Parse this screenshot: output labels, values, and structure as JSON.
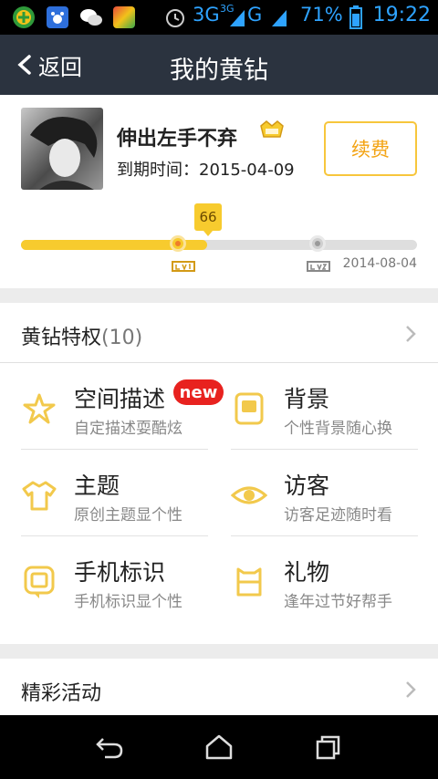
{
  "status_bar": {
    "network": "3G",
    "network_small": "3G",
    "network2": "G",
    "battery": "71%",
    "time": "19:22"
  },
  "header": {
    "back_label": "返回",
    "title": "我的黄钻"
  },
  "profile": {
    "username": "伸出左手不弃",
    "expiry_label": "到期时间：2015-04-09",
    "renew_label": "续费",
    "level": "66",
    "progress_fraction": 0.47,
    "next_date": "2014-08-04",
    "current_level_badge": "Lv1",
    "next_level_badge": "Lv2"
  },
  "privileges": {
    "title": "黄钻特权",
    "count": "(10)",
    "items": [
      {
        "title": "空间描述",
        "sub": "自定描述耍酷炫",
        "icon": "star-icon",
        "badge": "new"
      },
      {
        "title": "背景",
        "sub": "个性背景随心换",
        "icon": "picture-frame-icon"
      },
      {
        "title": "主题",
        "sub": "原创主题显个性",
        "icon": "tshirt-icon"
      },
      {
        "title": "访客",
        "sub": "访客足迹随时看",
        "icon": "eye-icon"
      },
      {
        "title": "手机标识",
        "sub": "手机标识显个性",
        "icon": "phone-tag-icon"
      },
      {
        "title": "礼物",
        "sub": "逢年过节好帮手",
        "icon": "gift-icon"
      }
    ]
  },
  "activities": {
    "title": "精彩活动"
  },
  "colors": {
    "accent": "#f7cb2e",
    "renew_text": "#f3a313",
    "header_bg": "#2b333f",
    "badge_red": "#e8221f"
  }
}
